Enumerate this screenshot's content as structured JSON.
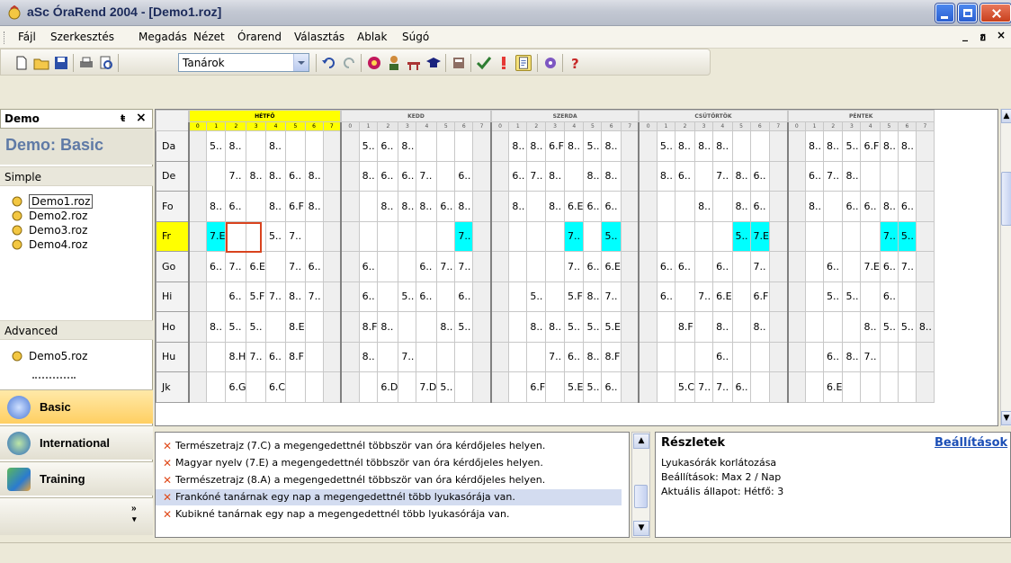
{
  "window": {
    "title": "aSc ÓraRend 2004  - [Demo1.roz]"
  },
  "menu": [
    "Fájl",
    "Szerkesztés",
    "Megadás",
    "Nézet",
    "Órarend",
    "Választás",
    "Ablak",
    "Súgó"
  ],
  "mdi_controls": [
    "_",
    "ฮ",
    "×"
  ],
  "toolbar": {
    "combo_value": "Tanárok"
  },
  "left_panel": {
    "title": "Demo",
    "pin": "ŧ",
    "close": "×",
    "header": "Demo: Basic",
    "groups": [
      {
        "label": "Simple",
        "items": [
          "Demo1.roz",
          "Demo2.roz",
          "Demo3.roz",
          "Demo4.roz"
        ]
      },
      {
        "label": "Advanced",
        "items": [
          "Demo5.roz"
        ]
      }
    ],
    "nav": [
      "Basic",
      "International",
      "Training"
    ],
    "nav_more": "»"
  },
  "timetable": {
    "days": [
      "HÉTFŐ",
      "KEDD",
      "SZERDA",
      "CSÜTÖRTÖK",
      "PÉNTEK"
    ],
    "periods": [
      "0",
      "1",
      "2",
      "3",
      "4",
      "5",
      "6",
      "7"
    ],
    "highlight_day": 0,
    "highlight_period": 3,
    "teachers": [
      "Da",
      "De",
      "Fo",
      "Fr",
      "Go",
      "Hi",
      "Ho",
      "Hu",
      "Jk"
    ],
    "highlight_teacher": 3,
    "rows": [
      [
        "",
        "5..",
        "8..",
        "",
        "8..",
        "",
        "",
        "",
        "",
        "5..",
        "6..",
        "8..",
        "",
        "",
        "",
        "",
        "",
        "8..",
        "8..",
        "6.F",
        "8..",
        "5..",
        "8..",
        "",
        "",
        "5..",
        "8..",
        "8..",
        "8..",
        "",
        "",
        "",
        "",
        "8..",
        "8..",
        "5..",
        "6.F",
        "8..",
        "8..",
        ""
      ],
      [
        "",
        "",
        "7..",
        "8..",
        "8..",
        "6..",
        "8..",
        "",
        "",
        "8..",
        "6..",
        "6..",
        "7..",
        "",
        "6..",
        "",
        "",
        "6..",
        "7..",
        "8..",
        "",
        "8..",
        "8..",
        "",
        "",
        "8..",
        "6..",
        "",
        "7..",
        "8..",
        "6..",
        "",
        "",
        "6..",
        "7..",
        "8..",
        "",
        "",
        "",
        ""
      ],
      [
        "",
        "8..",
        "6..",
        "",
        "8..",
        "6.F",
        "8..",
        "",
        "",
        "",
        "8..",
        "8..",
        "8..",
        "6..",
        "8..",
        "",
        "",
        "8..",
        "",
        "8..",
        "6.E",
        "6..",
        "6..",
        "",
        "",
        "",
        "",
        "8..",
        "",
        "8..",
        "6..",
        "",
        "",
        "8..",
        "",
        "6..",
        "6..",
        "8..",
        "6..",
        ""
      ],
      [
        "",
        "7.E",
        "",
        "",
        "5..",
        "7..",
        "",
        "",
        "",
        "",
        "",
        "",
        "",
        "",
        "7..",
        "",
        "",
        "",
        "",
        "",
        "7..",
        "",
        "5..",
        "",
        "",
        "",
        "",
        "",
        "",
        "5..",
        "7.E",
        "",
        "",
        "",
        "",
        "",
        "",
        "7..",
        "5..",
        ""
      ],
      [
        "",
        "6..",
        "7..",
        "6.E",
        "",
        "7..",
        "6..",
        "",
        "",
        "6..",
        "",
        "",
        "6..",
        "7..",
        "7..",
        "",
        "",
        "",
        "",
        "",
        "7..",
        "6..",
        "6.E",
        "",
        "",
        "6..",
        "6..",
        "",
        "6..",
        "",
        "7..",
        "",
        "",
        "",
        "6..",
        "",
        "7.E",
        "6..",
        "7..",
        ""
      ],
      [
        "",
        "",
        "6..",
        "5.F",
        "7..",
        "8..",
        "7..",
        "",
        "",
        "6..",
        "",
        "5..",
        "6..",
        "",
        "6..",
        "",
        "",
        "",
        "5..",
        "",
        "5.F",
        "8..",
        "7..",
        "",
        "",
        "6..",
        "",
        "7..",
        "6.E",
        "",
        "6.F",
        "",
        "",
        "",
        "5..",
        "5..",
        "",
        "6..",
        "",
        ""
      ],
      [
        "",
        "8..",
        "5..",
        "5..",
        "",
        "8.E",
        "",
        "",
        "",
        "8.F",
        "8..",
        "",
        "",
        "8..",
        "5..",
        "",
        "",
        "",
        "8..",
        "8..",
        "5..",
        "5..",
        "5.E",
        "",
        "",
        "",
        "8.F",
        "",
        "8..",
        "",
        "8..",
        "",
        "",
        "",
        "",
        "",
        "8..",
        "5..",
        "5..",
        "8.."
      ],
      [
        "",
        "",
        "8.H",
        "7..",
        "6..",
        "8.F",
        "",
        "",
        "",
        "8..",
        "",
        "7..",
        "",
        "",
        "",
        "",
        "",
        "",
        "",
        "7..",
        "6..",
        "8..",
        "8.F",
        "",
        "",
        "",
        "",
        "",
        "6..",
        "",
        "",
        "",
        "",
        "",
        "6..",
        "8..",
        "7..",
        "",
        "",
        ""
      ],
      [
        "",
        "",
        "6.G",
        "",
        "6.C",
        "",
        "",
        "",
        "",
        "",
        "6.D",
        "",
        "7.D",
        "5..",
        "",
        "",
        "",
        "",
        "6.F",
        "",
        "5.E",
        "5..",
        "6..",
        "",
        "",
        "",
        "5.C",
        "7..",
        "7..",
        "6..",
        "",
        "",
        "",
        "",
        "6.E",
        "",
        "",
        "",
        "",
        ""
      ]
    ],
    "cyan_cells": [
      [
        3,
        1
      ],
      [
        3,
        14
      ],
      [
        3,
        20
      ],
      [
        3,
        22
      ],
      [
        3,
        29
      ],
      [
        3,
        30
      ],
      [
        3,
        37
      ],
      [
        3,
        38
      ]
    ],
    "selected_cell": [
      3,
      2
    ]
  },
  "messages": [
    {
      "text": "Természetrajz (7.C) a megengedettnél többször van óra kérdőjeles helyen.",
      "selected": false
    },
    {
      "text": "Magyar nyelv (7.E) a megengedettnél többször van óra kérdőjeles helyen.",
      "selected": false
    },
    {
      "text": "Természetrajz (8.A) a megengedettnél többször van óra kérdőjeles helyen.",
      "selected": false
    },
    {
      "text": "Frankóné tanárnak egy nap a megengedettnél több lyukasórája van.",
      "selected": true
    },
    {
      "text": "Kubikné tanárnak egy nap a megengedettnél több lyukasórája van.",
      "selected": false
    }
  ],
  "details": {
    "title": "Részletek",
    "link": "Beállítások",
    "lines": [
      "Lyukasórák korlátozása",
      "Beállítások: Max 2 / Nap",
      "Aktuális állapot: Hétfő: 3"
    ]
  },
  "colors": {
    "highlight": "#ffff00",
    "cyan": "#00ffff",
    "selection": "#d9431e",
    "link": "#1c4fb6",
    "error_icon": "#e04b1b"
  }
}
